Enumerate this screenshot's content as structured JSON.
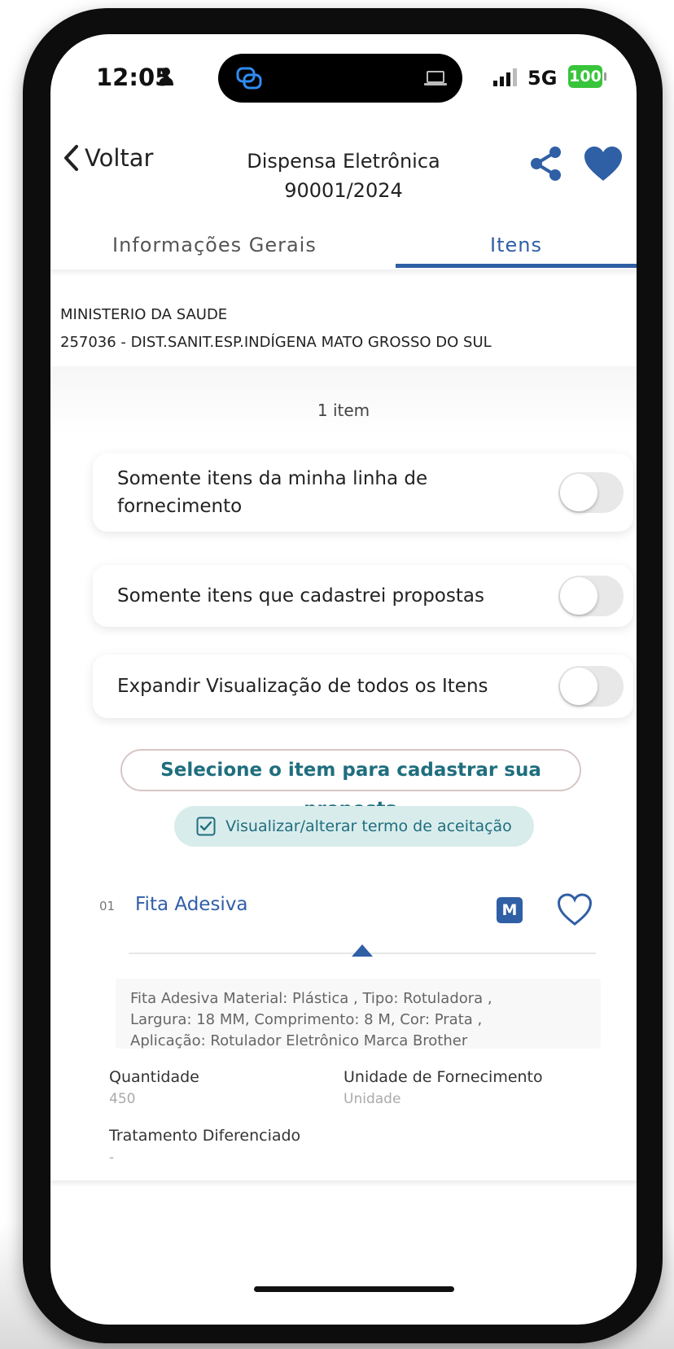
{
  "status": {
    "time": "12:05",
    "network": "5G",
    "battery": "100"
  },
  "header": {
    "back_label": "Voltar",
    "title_line1": "Dispensa Eletrônica",
    "title_line2": "90001/2024"
  },
  "tabs": [
    {
      "label": "Informações Gerais",
      "active": false
    },
    {
      "label": "Itens",
      "active": true
    }
  ],
  "org": {
    "ministry": "MINISTERIO DA SAUDE",
    "unit": "257036 - DIST.SANIT.ESP.INDÍGENA MATO GROSSO DO SUL"
  },
  "item_count": "1 item",
  "filters": [
    {
      "label_line1": "Somente itens da minha linha de",
      "label_line2": "fornecimento",
      "enabled": false
    },
    {
      "label": "Somente itens que cadastrei propostas",
      "enabled": false
    },
    {
      "label": "Expandir Visualização de todos os Itens",
      "enabled": false
    }
  ],
  "actions": {
    "select_item": "Selecione o item para cadastrar sua proposta",
    "terms": "Visualizar/alterar termo de aceitação"
  },
  "item": {
    "number": "01",
    "title": "Fita Adesiva",
    "badge": "M",
    "description_lines": [
      "Fita Adesiva Material: Plástica , Tipo: Rotuladora ,",
      "Largura: 18 MM, Comprimento: 8 M, Cor: Prata ,",
      "Aplicação: Rotulador Eletrônico Marca Brother"
    ],
    "quantity_label": "Quantidade",
    "quantity_value": "450",
    "unit_label": "Unidade de Fornecimento",
    "unit_value": "Unidade",
    "treatment_label": "Tratamento Diferenciado",
    "treatment_value": "-"
  },
  "colors": {
    "accent_blue": "#2f5fa5",
    "teal": "#1f6e7e",
    "battery_green": "#38c43b"
  }
}
